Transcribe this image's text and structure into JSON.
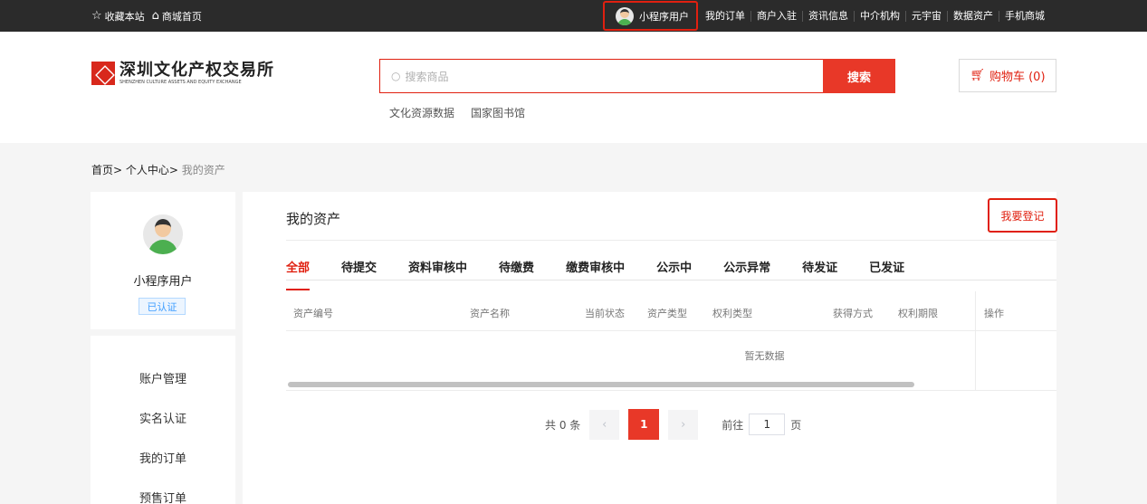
{
  "topbar": {
    "favorite": "收藏本站",
    "home": "商城首页",
    "user": "小程序用户",
    "links": [
      "我的订单",
      "商户入驻",
      "资讯信息",
      "中介机构",
      "元宇宙",
      "数据资产",
      "手机商城"
    ]
  },
  "header": {
    "logo_cn": "深圳文化产权交易所",
    "logo_en": "SHENZHEN CULTURE ASSETS AND EQUITY EXCHANGE",
    "search_placeholder": "搜索商品",
    "search_button": "搜索",
    "hot_links": [
      "文化资源数据",
      "国家图书馆"
    ],
    "cart": "购物车 (0)"
  },
  "breadcrumb": {
    "home": "首页>",
    "center": "个人中心>",
    "current": "我的资产"
  },
  "profile": {
    "name": "小程序用户",
    "badge": "已认证"
  },
  "menu": [
    "账户管理",
    "实名认证",
    "我的订单",
    "预售订单"
  ],
  "main": {
    "title": "我的资产",
    "register_button": "我要登记",
    "tabs": [
      "全部",
      "待提交",
      "资料审核中",
      "待缴费",
      "缴费审核中",
      "公示中",
      "公示异常",
      "待发证",
      "已发证"
    ],
    "active_tab": 0,
    "columns": [
      "资产编号",
      "资产名称",
      "当前状态",
      "资产类型",
      "权利类型",
      "获得方式",
      "权利期限",
      "操作"
    ],
    "empty_text": "暂无数据",
    "pager": {
      "total": "共 0 条",
      "prev": "‹",
      "current_page": "1",
      "next": "›",
      "goto_label": "前往",
      "goto_value": "1",
      "page_suffix": "页"
    }
  },
  "colors": {
    "accent": "#e83828",
    "topbar": "#2b2b2b"
  }
}
